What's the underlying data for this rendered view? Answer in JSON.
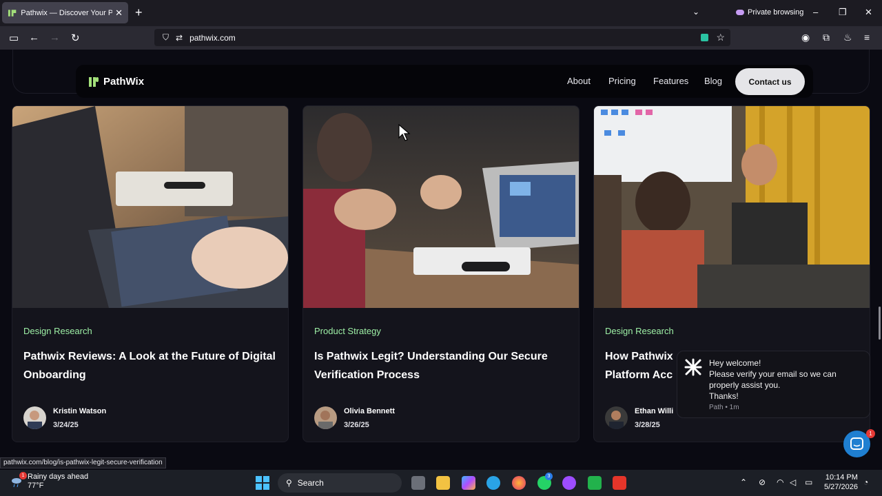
{
  "browser": {
    "tab_title": "Pathwix — Discover Your Path with",
    "close_tab": "✕",
    "new_tab": "+",
    "private_label": "Private browsing",
    "url": "pathwix.com",
    "status_url": "pathwix.com/blog/is-pathwix-legit-secure-verification"
  },
  "site": {
    "logo": "PathWix",
    "nav": [
      "About",
      "Pricing",
      "Features",
      "Blog"
    ],
    "cta": "Contact us"
  },
  "cards": [
    {
      "category": "Design Research",
      "title": "Pathwix Reviews: A Look at the Future of Digital Onboarding",
      "author": "Kristin Watson",
      "date": "3/24/25"
    },
    {
      "category": "Product Strategy",
      "title": "Is Pathwix Legit? Understanding Our Secure Verification Process",
      "author": "Olivia Bennett",
      "date": "3/26/25"
    },
    {
      "category": "Design Research",
      "title": "How Pathwix",
      "title2": "Platform Acc",
      "author": "Ethan Willi",
      "date": "3/28/25"
    }
  ],
  "chat": {
    "message": [
      "Hey welcome!",
      "Please verify your email so we can properly assist you.",
      "Thanks!"
    ],
    "meta": "Path • 1m",
    "badge": "1"
  },
  "taskbar": {
    "weather_title": "Rainy days ahead",
    "weather_temp": "77°F",
    "weather_badge": "1",
    "search": "Search",
    "time": "10:14 PM",
    "date": "5/27/2026",
    "whatsapp_badge": "3"
  },
  "colors": {
    "accent_green": "#9ef0a6",
    "chat_blue": "#1f7fd1"
  }
}
